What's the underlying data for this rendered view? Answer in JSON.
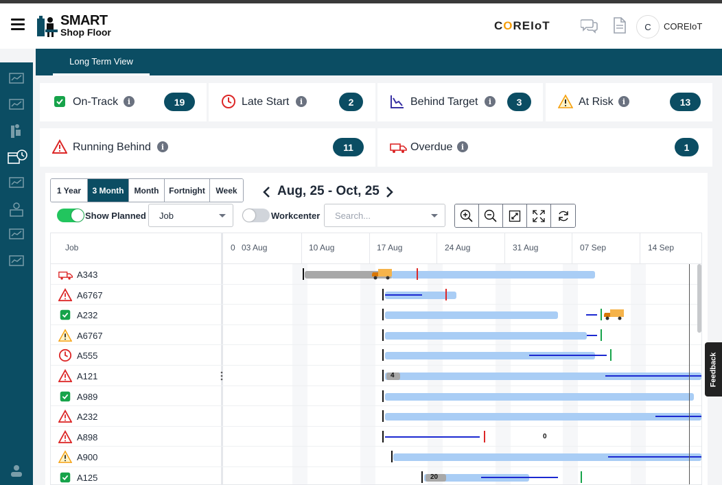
{
  "header": {
    "logo_line1": "SMART",
    "logo_line2": "Shop Floor",
    "brand": "C",
    "brand_o": "O",
    "brand_rest": "REIoT",
    "avatar_initial": "C",
    "user_name": "COREIoT"
  },
  "tabs": [
    {
      "label": "Long Term View",
      "active": true
    }
  ],
  "status_cards": [
    {
      "label": "On-Track",
      "count": "19",
      "icon": "check-box-icon",
      "color": "#16a34a"
    },
    {
      "label": "Late Start",
      "count": "2",
      "icon": "clock-icon",
      "color": "#dc2626"
    },
    {
      "label": "Behind Target",
      "count": "3",
      "icon": "trend-down-icon",
      "color": "#3730a3"
    },
    {
      "label": "At Risk",
      "count": "13",
      "icon": "warning-icon",
      "color": "#f59e0b"
    },
    {
      "label": "Running Behind",
      "count": "11",
      "icon": "alert-triangle-icon",
      "color": "#dc2626"
    },
    {
      "label": "Overdue",
      "count": "1",
      "icon": "truck-icon",
      "color": "#dc2626"
    }
  ],
  "period_buttons": [
    {
      "label": "1 Year",
      "active": false
    },
    {
      "label": "3 Month",
      "active": true
    },
    {
      "label": "Month",
      "active": false
    },
    {
      "label": "Fortnight",
      "active": false
    },
    {
      "label": "Week",
      "active": false
    }
  ],
  "date_range": "Aug, 25 - Oct, 25",
  "controls": {
    "show_planned_label": "Show Planned",
    "show_planned_on": true,
    "group_select_value": "Job",
    "workcenter_label": "Workcenter",
    "workcenter_on": false,
    "search_placeholder": "Search..."
  },
  "grid": {
    "job_column_label": "Job",
    "date_headers": [
      "0",
      "03 Aug",
      "10 Aug",
      "17 Aug",
      "24 Aug",
      "31 Aug",
      "07 Sep",
      "14 Sep"
    ],
    "rows": [
      {
        "job": "A343",
        "status": "truck-icon"
      },
      {
        "job": "A6767",
        "status": "alert-triangle-icon"
      },
      {
        "job": "A232",
        "status": "check-box-icon"
      },
      {
        "job": "A6767",
        "status": "warning-icon"
      },
      {
        "job": "A555",
        "status": "clock-icon"
      },
      {
        "job": "A121",
        "status": "alert-triangle-icon"
      },
      {
        "job": "A989",
        "status": "check-box-icon"
      },
      {
        "job": "A232",
        "status": "alert-triangle-icon"
      },
      {
        "job": "A898",
        "status": "alert-triangle-icon"
      },
      {
        "job": "A900",
        "status": "warning-icon"
      },
      {
        "job": "A125",
        "status": "check-box-icon"
      }
    ],
    "bar_badges": [
      "4",
      "0",
      "20"
    ]
  },
  "feedback_label": "Feedback"
}
